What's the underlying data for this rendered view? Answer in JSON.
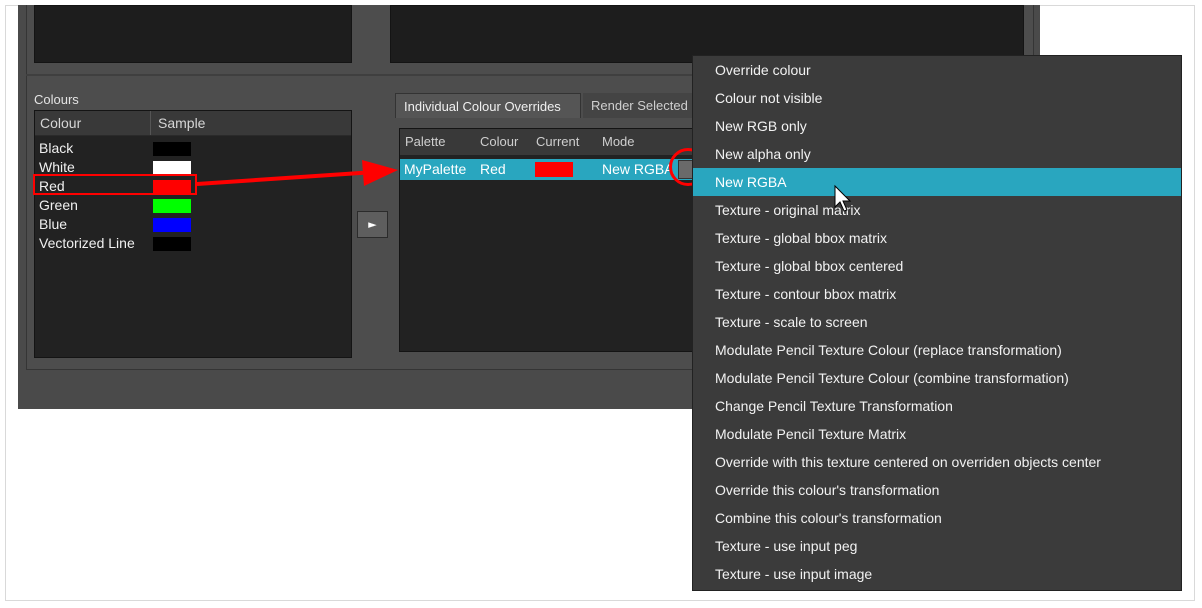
{
  "colours_panel": {
    "label": "Colours",
    "columns": [
      "Colour",
      "Sample"
    ],
    "rows": [
      {
        "name": "Black",
        "color": "#000000"
      },
      {
        "name": "White",
        "color": "#ffffff"
      },
      {
        "name": "Red",
        "color": "#ff0000"
      },
      {
        "name": "Green",
        "color": "#00ff00"
      },
      {
        "name": "Blue",
        "color": "#0000ff"
      },
      {
        "name": "Vectorized Line",
        "color": "#000000"
      }
    ]
  },
  "move_button": {
    "glyph": "►"
  },
  "tabs": [
    {
      "label": "Individual Colour Overrides"
    },
    {
      "label": "Render Selected"
    }
  ],
  "overrides_table": {
    "columns": [
      "Palette",
      "Colour",
      "Current",
      "Mode"
    ],
    "row": {
      "palette": "MyPalette",
      "colour": "Red",
      "current_color": "#ff0000",
      "mode": "New RGBA"
    }
  },
  "context_menu": {
    "items": [
      "Override colour",
      "Colour not visible",
      "New RGB only",
      "New alpha only",
      "New RGBA",
      "Texture - original matrix",
      "Texture - global bbox matrix",
      "Texture - global bbox centered",
      "Texture - contour bbox matrix",
      "Texture - scale to screen",
      "Modulate Pencil Texture Colour (replace transformation)",
      "Modulate Pencil Texture Colour (combine transformation)",
      "Change Pencil Texture Transformation",
      "Modulate Pencil Texture Matrix",
      "Override with this texture centered on overriden objects center",
      "Override this colour's transformation",
      "Combine this colour's transformation",
      "Texture - use input peg",
      "Texture - use input image"
    ],
    "highlighted": "New RGBA"
  },
  "colors": {
    "selection": "#29a6bf",
    "annotation": "#ff0000"
  }
}
